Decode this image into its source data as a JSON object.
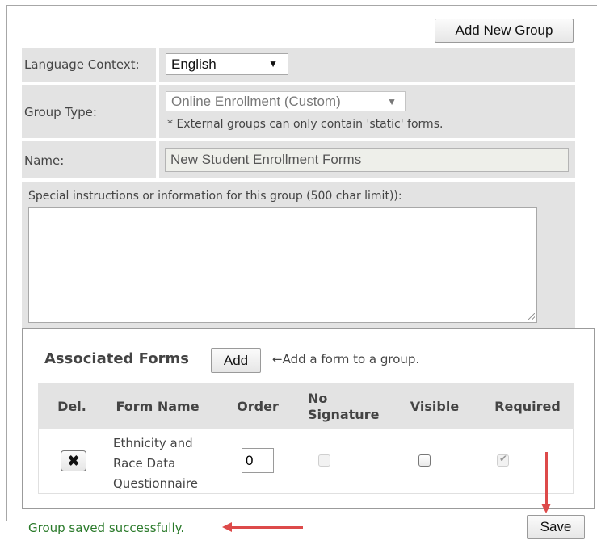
{
  "toolbar": {
    "add_new_group": "Add New Group"
  },
  "form": {
    "language_context_label": "Language Context:",
    "language_value": "English",
    "group_type_label": "Group Type:",
    "group_type_value": "Online Enrollment (Custom)",
    "group_type_note": "* External groups can only contain 'static' forms.",
    "name_label": "Name:",
    "name_value": "New Student Enrollment Forms",
    "instructions_label": "Special instructions or information for this group (500 char limit)):",
    "instructions_value": ""
  },
  "associated": {
    "title": "Associated Forms",
    "add_label": "Add",
    "add_hint": "←Add a form to a group.",
    "columns": [
      "Del.",
      "Form Name",
      "Order",
      "No Signature",
      "Visible",
      "Required"
    ],
    "rows": [
      {
        "form_name_line1": "Ethnicity and",
        "form_name_line2": "Race Data",
        "form_name_line3": "Questionnaire",
        "order": "0",
        "no_signature": false,
        "visible": false,
        "required": true
      }
    ]
  },
  "footer": {
    "status": "Group saved successfully.",
    "save_label": "Save",
    "status_color": "#2a7a2a",
    "annotation_color": "#dd4a4a"
  }
}
